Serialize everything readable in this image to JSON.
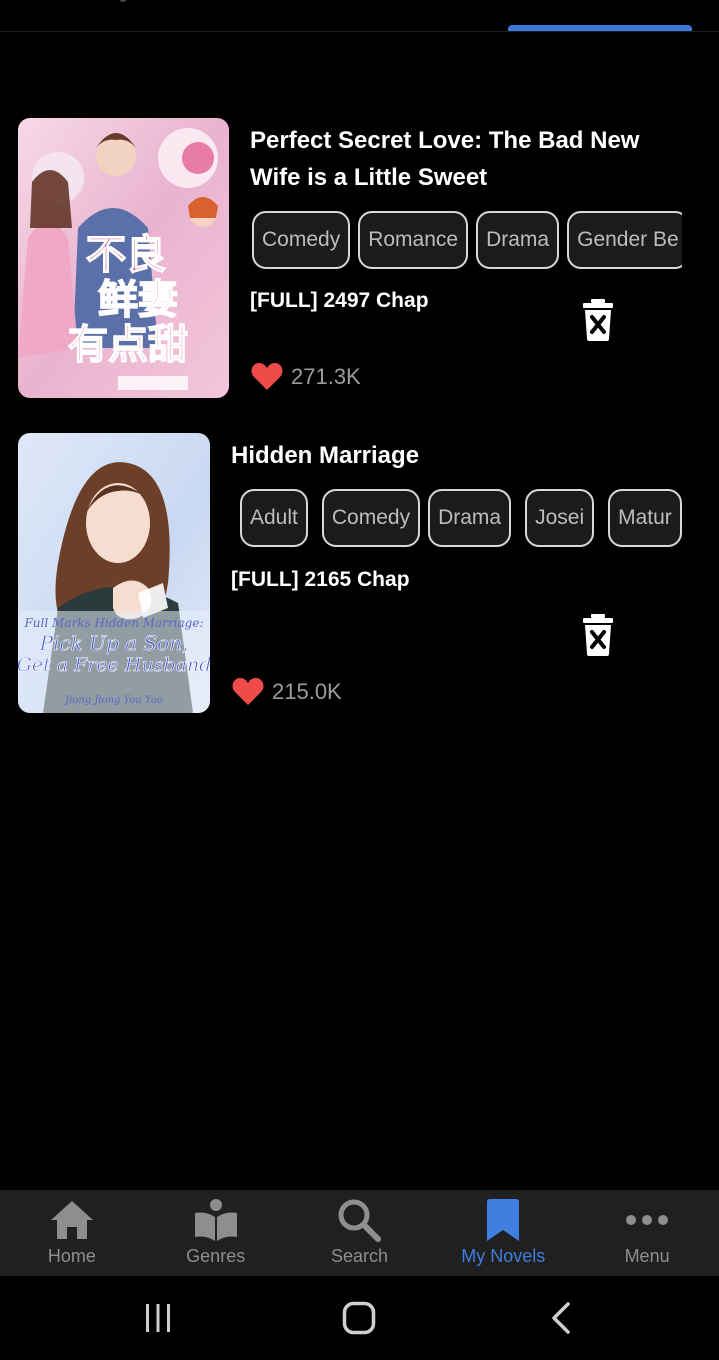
{
  "novels": [
    {
      "title_line1": "Perfect Secret Love: The Bad New",
      "title_line2": "Wife is a Little Sweet",
      "tags": [
        "Comedy",
        "Romance",
        "Drama",
        "Gender Be"
      ],
      "chapters": "[FULL] 2497 Chap",
      "likes": "271.3K",
      "cover_icon": "book-cover-image"
    },
    {
      "title_line1": "Hidden Marriage",
      "tags": [
        "Adult",
        "Comedy",
        "Drama",
        "Josei",
        "Matur"
      ],
      "chapters": "[FULL] 2165 Chap",
      "likes": "215.0K",
      "cover_icon": "book-cover-image",
      "cover_lines": [
        "Full Marks Hidden Marriage:",
        "Pick Up a Son,",
        "Get a Free Husband",
        "Jiong Jiong You Yao"
      ]
    }
  ],
  "nav": {
    "items": [
      {
        "label": "Home",
        "icon": "home-icon"
      },
      {
        "label": "Genres",
        "icon": "genres-icon"
      },
      {
        "label": "Search",
        "icon": "search-icon"
      },
      {
        "label": "My Novels",
        "icon": "bookmark-icon"
      },
      {
        "label": "Menu",
        "icon": "more-icon"
      }
    ],
    "active": "My Novels"
  },
  "colors": {
    "background": "#000000",
    "accent": "#3f7fe0",
    "heart": "#ef4b4b",
    "nav_bg": "#202020",
    "tag_border": "#d8d8d8"
  }
}
